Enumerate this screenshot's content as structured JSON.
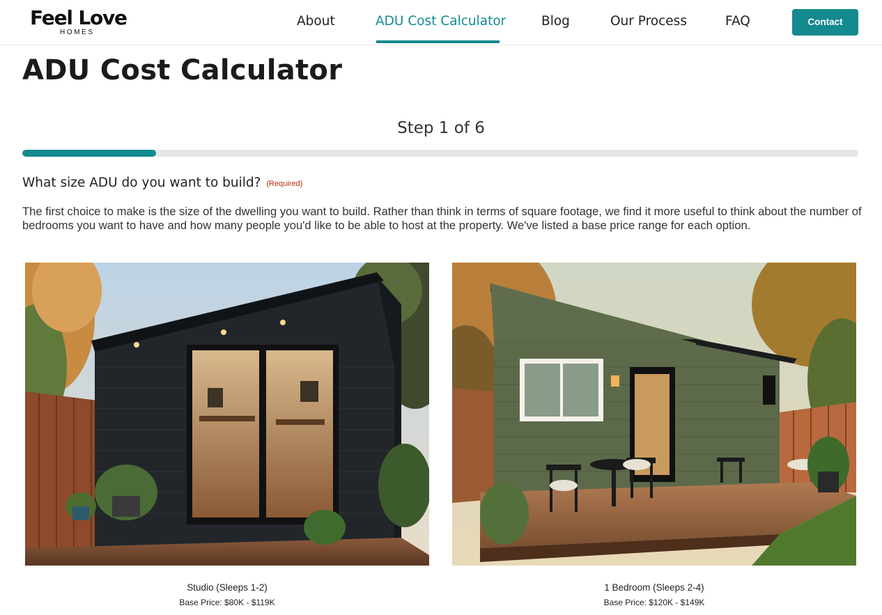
{
  "header": {
    "logo_main": "Feel Love",
    "logo_sub": "HOMES",
    "nav": [
      "About",
      "ADU Cost Calculator",
      "Blog",
      "Our Process",
      "FAQ"
    ],
    "active_nav": "ADU Cost Calculator",
    "contact_label": "Contact"
  },
  "page": {
    "title": "ADU Cost Calculator",
    "step_label": "Step 1 of 6",
    "progress": 0.16,
    "question": "What size ADU do you want to build?",
    "required_label": "(Required)",
    "intro": "The first choice to make is the size of the dwelling you want to build. Rather than think in terms of square footage, we find it more useful to think about the number of bedrooms you want to have and how many people you'd like to be able to host at the property. We've listed a base price range for each option."
  },
  "options": [
    {
      "label": "Studio (Sleeps 1-2)",
      "price": "Base Price: $80K - $119K"
    },
    {
      "label": "1 Bedroom (Sleeps 2-4)",
      "price": "Base Price: $120K - $149K"
    }
  ],
  "colors": {
    "accent": "#138a8f",
    "progress_track": "#e6e6e6",
    "required": "#c02b0a"
  },
  "icons": {
    "studio_image": "studio-adu-photo",
    "bedroom_image": "one-bedroom-adu-photo"
  }
}
